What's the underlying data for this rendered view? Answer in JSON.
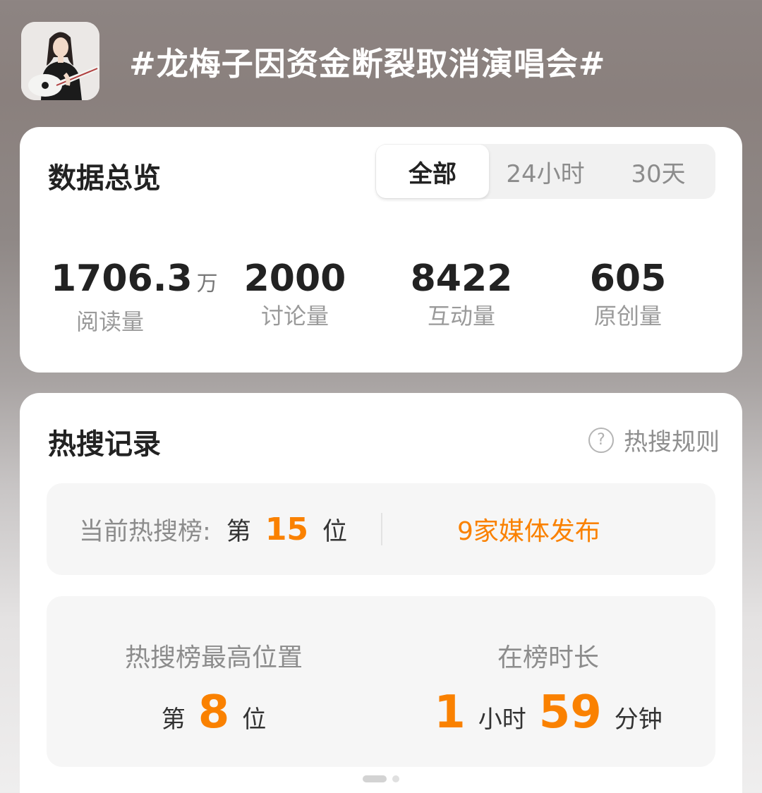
{
  "topic": {
    "title": "#龙梅子因资金断裂取消演唱会#"
  },
  "overview": {
    "heading": "数据总览",
    "tabs": [
      {
        "label": "全部",
        "active": true
      },
      {
        "label": "24小时",
        "active": false
      },
      {
        "label": "30天",
        "active": false
      }
    ],
    "stats": [
      {
        "value": "1706.3",
        "unit": "万",
        "label": "阅读量"
      },
      {
        "value": "2000",
        "unit": "",
        "label": "讨论量"
      },
      {
        "value": "8422",
        "unit": "",
        "label": "互动量"
      },
      {
        "value": "605",
        "unit": "",
        "label": "原创量"
      }
    ]
  },
  "hot_search": {
    "heading": "热搜记录",
    "rules_label": "热搜规则",
    "help_glyph": "?",
    "current": {
      "label": "当前热搜榜:",
      "prefix": "第",
      "rank": "15",
      "suffix": "位",
      "media": "9家媒体发布"
    },
    "peak": {
      "label": "热搜榜最高位置",
      "prefix": "第",
      "rank": "8",
      "suffix": "位"
    },
    "duration": {
      "label": "在榜时长",
      "hours": "1",
      "hours_unit": "小时",
      "minutes": "59",
      "minutes_unit": "分钟"
    }
  },
  "colors": {
    "accent": "#fa8100",
    "card_bg": "#ffffff",
    "panel_bg": "#f6f6f6"
  }
}
